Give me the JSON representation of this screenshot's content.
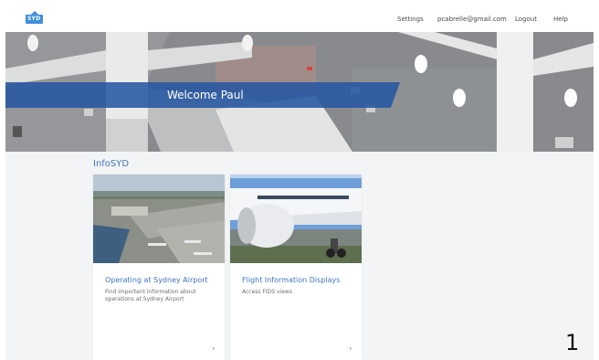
{
  "header": {
    "logo_text": "SYD",
    "nav": [
      "Settings",
      "pcabrelle@gmail.com",
      "Logout",
      "Help"
    ]
  },
  "hero": {
    "welcome": "Welcome Paul"
  },
  "section": {
    "title": "InfoSYD"
  },
  "cards": [
    {
      "title": "Operating at Sydney Airport",
      "description": "Find important information about operations at Sydney Airport",
      "chevron": "›"
    },
    {
      "title": "Flight Information Displays",
      "description": "Access FIDS views",
      "chevron": "›"
    }
  ],
  "page_number": "1",
  "colors": {
    "accent": "#3f75c4",
    "band": "#2656a0",
    "logo": "#3f8fd8"
  },
  "icons": {
    "logo": "syd-logo-icon",
    "card_arrow": "chevron-right-icon"
  }
}
